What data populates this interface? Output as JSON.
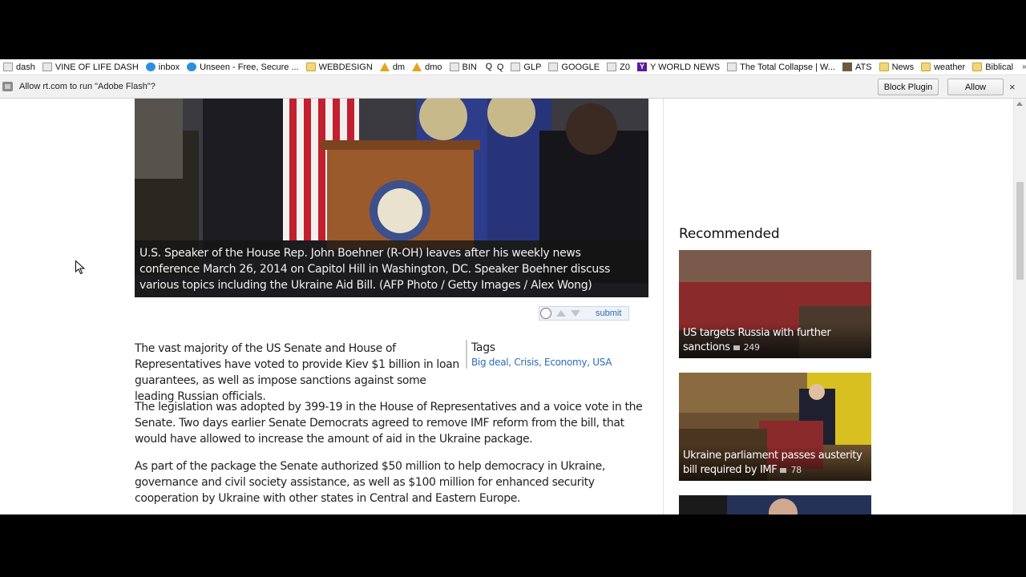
{
  "bookmarks": [
    {
      "label": "dash",
      "icon": "page-icon"
    },
    {
      "label": "VINE OF LIFE DASH",
      "icon": "page-icon"
    },
    {
      "label": "inbox",
      "icon": "globe-icon"
    },
    {
      "label": "Unseen - Free, Secure ...",
      "icon": "globe-icon"
    },
    {
      "label": "WEBDESIGN",
      "icon": "folder-icon"
    },
    {
      "label": "dm",
      "icon": "warning-icon"
    },
    {
      "label": "dmo",
      "icon": "warning-icon"
    },
    {
      "label": "BIN",
      "icon": "page-icon"
    },
    {
      "label": "Q",
      "icon": "q-icon"
    },
    {
      "label": "GLP",
      "icon": "page-icon"
    },
    {
      "label": "GOOGLE",
      "icon": "page-icon"
    },
    {
      "label": "Z0",
      "icon": "page-icon"
    },
    {
      "label": "Y WORLD NEWS",
      "icon": "yahoo-icon"
    },
    {
      "label": "The Total Collapse | W...",
      "icon": "page-icon"
    },
    {
      "label": "ATS",
      "icon": "image-icon"
    },
    {
      "label": "News",
      "icon": "folder-icon"
    },
    {
      "label": "weather",
      "icon": "folder-icon"
    },
    {
      "label": "Biblical",
      "icon": "folder-icon"
    }
  ],
  "bookmarks_more": "»",
  "flashbar": {
    "message": "Allow rt.com to run \"Adobe Flash\"?",
    "block_label": "Block Plugin",
    "allow_label": "Allow",
    "close_label": "×"
  },
  "article": {
    "caption": "U.S. Speaker of the House Rep. John Boehner (R-OH) leaves after his weekly news conference March 26, 2014 on Capitol Hill in Washington, DC. Speaker Boehner discuss various topics including the Ukraine Aid Bill. (AFP Photo / Getty Images / Alex Wong)",
    "reddit_submit": "submit",
    "paragraphs": [
      "The vast majority of the US Senate and House of Representatives have voted to provide Kiev $1 billion in loan guarantees, as well as impose sanctions against some leading Russian officials.",
      "The legislation was adopted by 399-19 in the House of Representatives and a voice vote in the Senate. Two days earlier Senate Democrats agreed to remove IMF reform from the bill, that would have allowed to increase the amount of aid in the Ukraine package.",
      "As part of the package the Senate authorized $50 million to help democracy in Ukraine, governance and civil society assistance, as well as $100 million for enhanced security cooperation by Ukraine with other states in Central and Eastern Europe."
    ],
    "tags_title": "Tags",
    "tags": [
      "Big deal",
      "Crisis",
      "Economy",
      "USA"
    ]
  },
  "sidebar": {
    "title": "Recommended",
    "cards": [
      {
        "title": "US targets Russia with further sanctions",
        "comments": "249"
      },
      {
        "title": "Ukraine parliament passes austerity bill required by IMF",
        "comments": "78"
      }
    ]
  }
}
